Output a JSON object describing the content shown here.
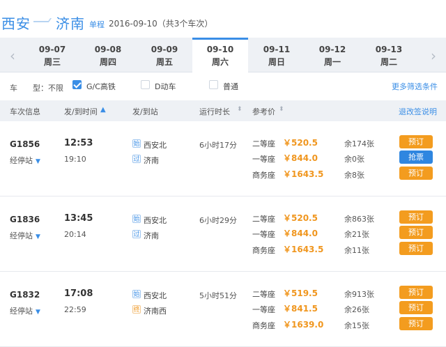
{
  "route": {
    "from": "西安",
    "to": "济南",
    "trip_type": "单程",
    "date_summary": "2016-09-10（共3个车次）"
  },
  "dates": [
    {
      "date": "09-07",
      "weekday": "周三"
    },
    {
      "date": "09-08",
      "weekday": "周四"
    },
    {
      "date": "09-09",
      "weekday": "周五"
    },
    {
      "date": "09-10",
      "weekday": "周六",
      "active": true
    },
    {
      "date": "09-11",
      "weekday": "周日"
    },
    {
      "date": "09-12",
      "weekday": "周一"
    },
    {
      "date": "09-13",
      "weekday": "周二"
    }
  ],
  "nav": {
    "prev": "‹",
    "next": "›"
  },
  "filter": {
    "label": "车　　型：不限",
    "options": [
      {
        "label": "G/C高铁",
        "checked": true
      },
      {
        "label": "D动车",
        "checked": false
      },
      {
        "label": "普通",
        "checked": false
      }
    ],
    "more": "更多筛选条件"
  },
  "columns": {
    "train": "车次信息",
    "time": "发/到时间",
    "time_sort": "▲",
    "station": "发/到站",
    "duration": "运行时长",
    "duration_sort": "⬍",
    "price": "参考价",
    "price_sort": "⬍",
    "refund": "退改签说明"
  },
  "trains": [
    {
      "number": "G1856",
      "stops": "经停站",
      "depart": "12:53",
      "arrive": "19:10",
      "from_tag": "始",
      "from_station": "西安北",
      "to_tag": "过",
      "to_station": "济南",
      "duration": "6小时17分",
      "seats": [
        {
          "class": "二等座",
          "price": "￥520.5",
          "remaining": "余174张",
          "action": "预订",
          "grab": false
        },
        {
          "class": "一等座",
          "price": "￥844.0",
          "remaining": "余0张",
          "action": "抢票",
          "grab": true
        },
        {
          "class": "商务座",
          "price": "￥1643.5",
          "remaining": "余8张",
          "action": "预订",
          "grab": false
        }
      ]
    },
    {
      "number": "G1836",
      "stops": "经停站",
      "depart": "13:45",
      "arrive": "20:14",
      "from_tag": "始",
      "from_station": "西安北",
      "to_tag": "过",
      "to_station": "济南",
      "duration": "6小时29分",
      "seats": [
        {
          "class": "二等座",
          "price": "￥520.5",
          "remaining": "余863张",
          "action": "预订",
          "grab": false
        },
        {
          "class": "一等座",
          "price": "￥844.0",
          "remaining": "余21张",
          "action": "预订",
          "grab": false
        },
        {
          "class": "商务座",
          "price": "￥1643.5",
          "remaining": "余11张",
          "action": "预订",
          "grab": false
        }
      ]
    },
    {
      "number": "G1832",
      "stops": "经停站",
      "depart": "17:08",
      "arrive": "22:59",
      "from_tag": "始",
      "from_station": "西安北",
      "to_tag": "终",
      "to_station": "济南西",
      "duration": "5小时51分",
      "seats": [
        {
          "class": "二等座",
          "price": "￥519.5",
          "remaining": "余913张",
          "action": "预订",
          "grab": false
        },
        {
          "class": "一等座",
          "price": "￥841.5",
          "remaining": "余26张",
          "action": "预订",
          "grab": false
        },
        {
          "class": "商务座",
          "price": "￥1639.0",
          "remaining": "余15张",
          "action": "预订",
          "grab": false
        }
      ]
    }
  ],
  "colors": {
    "accent": "#3a8ee6",
    "price": "#f0961e",
    "book": "#f39c1f",
    "grab": "#2f86e0"
  }
}
